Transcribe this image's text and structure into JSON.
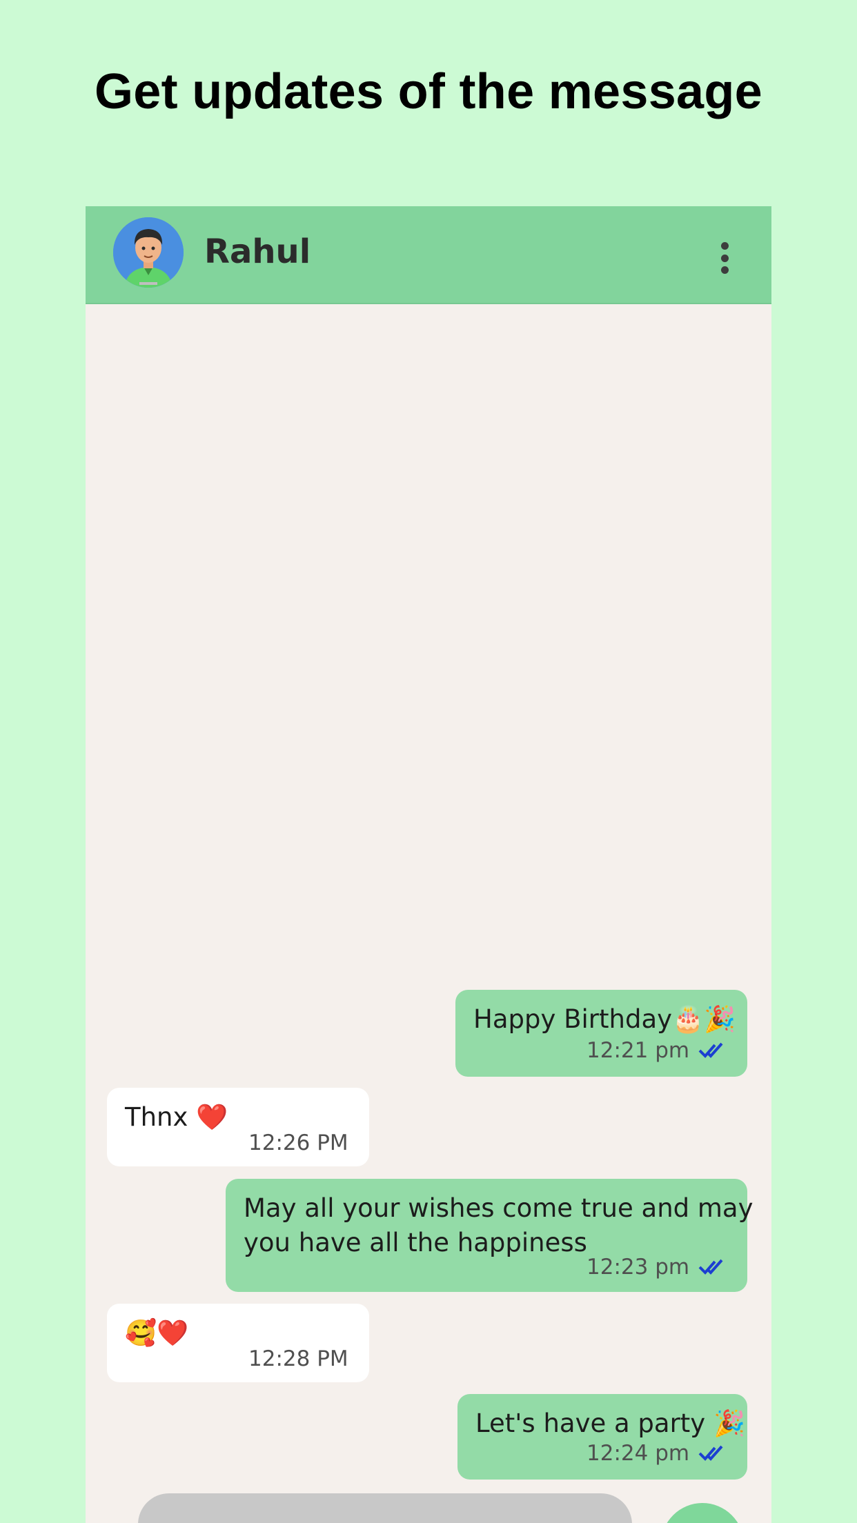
{
  "headline": "Get updates of the message",
  "chat": {
    "contact_name": "Rahul",
    "messages": [
      {
        "direction": "out",
        "text": "Happy Birthday🎂🎉",
        "time": "12:21 pm",
        "status": "read"
      },
      {
        "direction": "in",
        "text": "Thnx ❤️",
        "time": "12:26 PM"
      },
      {
        "direction": "out",
        "lines": [
          "May all your wishes come true and may",
          "you have all the happiness"
        ],
        "time": "12:23 pm",
        "status": "read"
      },
      {
        "direction": "in",
        "text": "🥰❤️",
        "time": "12:28 PM"
      },
      {
        "direction": "out",
        "text": "Let's have a party 🎉",
        "time": "12:24 pm",
        "status": "read"
      }
    ]
  },
  "colors": {
    "page_bg": "#ccfad4",
    "header_bg": "#82d49c",
    "chat_bg": "#f5f0ec",
    "outgoing_bubble": "#93dba7",
    "incoming_bubble": "#ffffff",
    "read_tick": "#1c3fd1"
  },
  "icons": {
    "menu": "more-vert-icon",
    "read_status": "double-check-icon",
    "avatar": "avatar-icon"
  }
}
